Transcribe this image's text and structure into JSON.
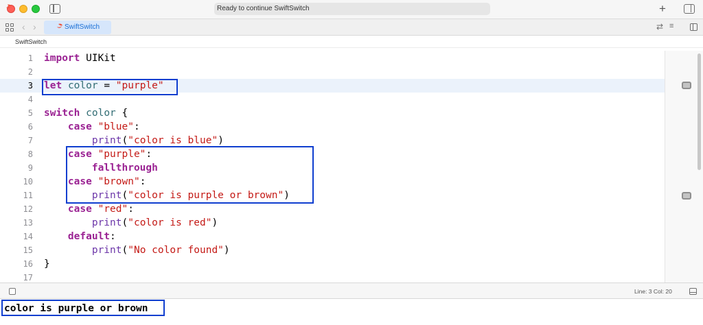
{
  "window": {
    "status_text": "Ready to continue SwiftSwitch",
    "plus_label": "+"
  },
  "tabs": [
    {
      "label": "SwiftSwitch",
      "active": true
    }
  ],
  "nav": {
    "back": "‹",
    "forward": "›"
  },
  "toolbar_right": {
    "swap_icon": "⇄",
    "lines_icon": "≡"
  },
  "breadcrumb": {
    "file": "SwiftSwitch"
  },
  "editor": {
    "current_line": 3,
    "lines": [
      {
        "num": "1",
        "tokens": [
          {
            "t": "import",
            "c": "kw"
          },
          {
            "t": " UIKit",
            "c": ""
          }
        ]
      },
      {
        "num": "2",
        "tokens": []
      },
      {
        "num": "3",
        "tokens": [
          {
            "t": "let",
            "c": "kw"
          },
          {
            "t": " ",
            "c": ""
          },
          {
            "t": "color",
            "c": "var"
          },
          {
            "t": " = ",
            "c": ""
          },
          {
            "t": "\"purple\"",
            "c": "str"
          }
        ]
      },
      {
        "num": "4",
        "tokens": []
      },
      {
        "num": "5",
        "tokens": [
          {
            "t": "switch",
            "c": "kw"
          },
          {
            "t": " ",
            "c": ""
          },
          {
            "t": "color",
            "c": "var"
          },
          {
            "t": " {",
            "c": ""
          }
        ]
      },
      {
        "num": "6",
        "tokens": [
          {
            "t": "    ",
            "c": ""
          },
          {
            "t": "case",
            "c": "kw"
          },
          {
            "t": " ",
            "c": ""
          },
          {
            "t": "\"blue\"",
            "c": "str"
          },
          {
            "t": ":",
            "c": ""
          }
        ]
      },
      {
        "num": "7",
        "tokens": [
          {
            "t": "        ",
            "c": ""
          },
          {
            "t": "print",
            "c": "fn"
          },
          {
            "t": "(",
            "c": ""
          },
          {
            "t": "\"color is blue\"",
            "c": "str"
          },
          {
            "t": ")",
            "c": ""
          }
        ]
      },
      {
        "num": "8",
        "tokens": [
          {
            "t": "    ",
            "c": ""
          },
          {
            "t": "case",
            "c": "kw"
          },
          {
            "t": " ",
            "c": ""
          },
          {
            "t": "\"purple\"",
            "c": "str"
          },
          {
            "t": ":",
            "c": ""
          }
        ]
      },
      {
        "num": "9",
        "tokens": [
          {
            "t": "        ",
            "c": ""
          },
          {
            "t": "fallthrough",
            "c": "kw"
          }
        ]
      },
      {
        "num": "10",
        "tokens": [
          {
            "t": "    ",
            "c": ""
          },
          {
            "t": "case",
            "c": "kw"
          },
          {
            "t": " ",
            "c": ""
          },
          {
            "t": "\"brown\"",
            "c": "str"
          },
          {
            "t": ":",
            "c": ""
          }
        ]
      },
      {
        "num": "11",
        "tokens": [
          {
            "t": "        ",
            "c": ""
          },
          {
            "t": "print",
            "c": "fn"
          },
          {
            "t": "(",
            "c": ""
          },
          {
            "t": "\"color is purple or brown\"",
            "c": "str"
          },
          {
            "t": ")",
            "c": ""
          }
        ]
      },
      {
        "num": "12",
        "tokens": [
          {
            "t": "    ",
            "c": ""
          },
          {
            "t": "case",
            "c": "kw"
          },
          {
            "t": " ",
            "c": ""
          },
          {
            "t": "\"red\"",
            "c": "str"
          },
          {
            "t": ":",
            "c": ""
          }
        ]
      },
      {
        "num": "13",
        "tokens": [
          {
            "t": "        ",
            "c": ""
          },
          {
            "t": "print",
            "c": "fn"
          },
          {
            "t": "(",
            "c": ""
          },
          {
            "t": "\"color is red\"",
            "c": "str"
          },
          {
            "t": ")",
            "c": ""
          }
        ]
      },
      {
        "num": "14",
        "tokens": [
          {
            "t": "    ",
            "c": ""
          },
          {
            "t": "default",
            "c": "kw"
          },
          {
            "t": ":",
            "c": ""
          }
        ]
      },
      {
        "num": "15",
        "tokens": [
          {
            "t": "        ",
            "c": ""
          },
          {
            "t": "print",
            "c": "fn"
          },
          {
            "t": "(",
            "c": ""
          },
          {
            "t": "\"No color found\"",
            "c": "str"
          },
          {
            "t": ")",
            "c": ""
          }
        ]
      },
      {
        "num": "16",
        "tokens": [
          {
            "t": "}",
            "c": ""
          }
        ]
      },
      {
        "num": "17",
        "tokens": []
      }
    ]
  },
  "debug_bar": {
    "status": "Line: 3  Col: 20"
  },
  "console": {
    "output": "color is purple or brown"
  },
  "colors": {
    "keyword": "#9b2393",
    "string": "#c41a16",
    "variable": "#326d74",
    "function": "#6c36a9",
    "highlight_box": "#0f3ecf",
    "current_line": "#ebf2fb",
    "tab_active": "#d6e6fb"
  },
  "icons": [
    "sidebar-icon",
    "plus-icon",
    "right-panel-icon",
    "grid-icon",
    "chevron-left-icon",
    "chevron-right-icon",
    "swift-icon",
    "swap-icon",
    "lines-icon",
    "inspector-icon",
    "minimap-badge-icon",
    "checkbox-icon",
    "debug-toggle-icon"
  ]
}
